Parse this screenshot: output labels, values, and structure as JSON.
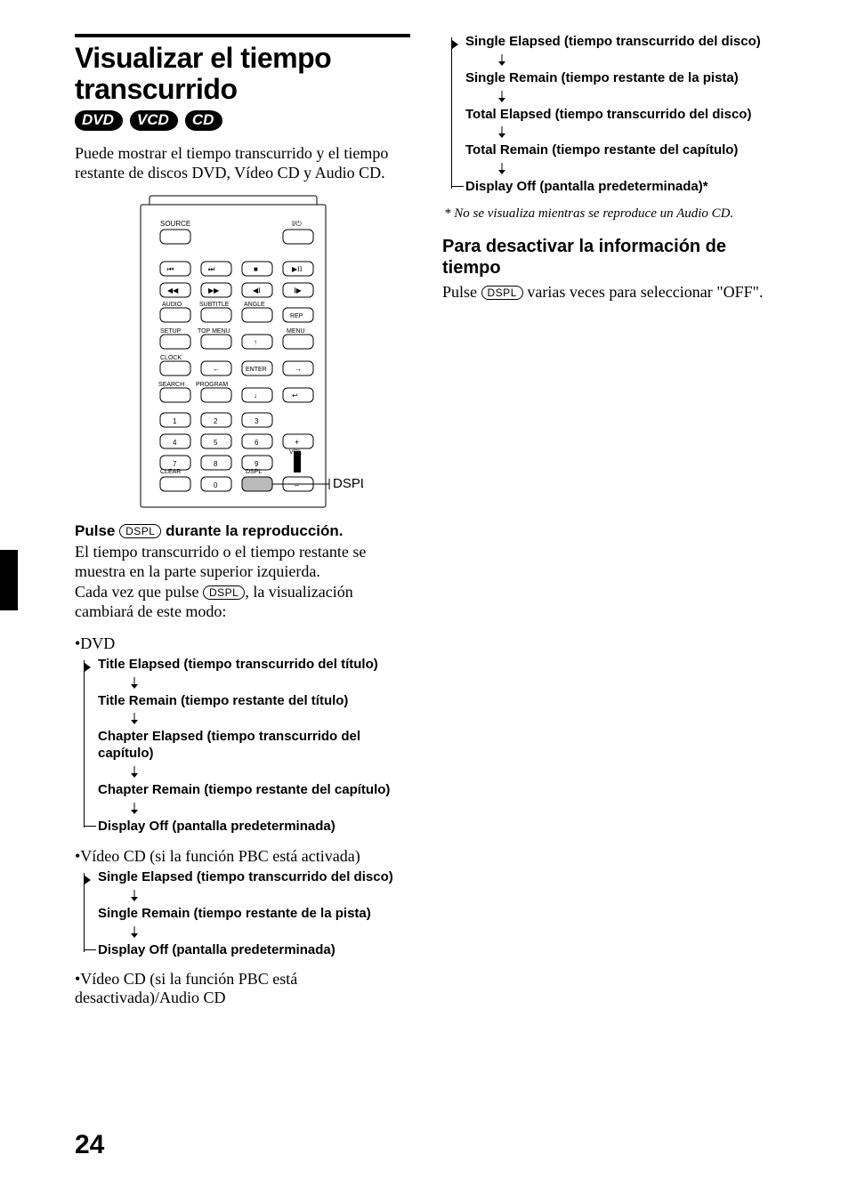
{
  "pageNumber": "24",
  "heading": "Visualizar el tiempo transcurrido",
  "badges": [
    "DVD",
    "VCD",
    "CD"
  ],
  "intro": "Puede mostrar el tiempo transcurrido y el tiempo restante de discos DVD, Vídeo CD y Audio CD.",
  "remote": {
    "labels": {
      "source": "SOURCE",
      "power": "⏻",
      "audio": "AUDIO",
      "subtitle": "SUBTITLE",
      "angle": "ANGLE",
      "rep": "REP",
      "setup": "SETUP",
      "topmenu": "TOP MENU",
      "menu": "MENU",
      "clock": "CLOCK",
      "enter": "ENTER",
      "search": "SEARCH",
      "program": "PROGRAM",
      "clear": "CLEAR",
      "dspl": "DSPL",
      "vol": "VOL"
    },
    "callout": "DSPL"
  },
  "instruction": {
    "prefix": "Pulse ",
    "button": "DSPL",
    "suffix": " durante la reproducción.",
    "line2": "El tiempo transcurrido o el tiempo restante se muestra en la parte superior izquierda.",
    "line3a": "Cada vez que pulse ",
    "line3btn": "DSPL",
    "line3b": ", la visualización cambiará de este modo:"
  },
  "sections": [
    {
      "head": "•DVD",
      "items": [
        "Title Elapsed (tiempo transcurrido del título)",
        "Title Remain (tiempo restante del título)",
        "Chapter Elapsed (tiempo transcurrido del capítulo)",
        "Chapter Remain (tiempo restante del capítulo)",
        "Display Off (pantalla predeterminada)"
      ]
    },
    {
      "head": "•Vídeo CD (si la función PBC está activada)",
      "items": [
        "Single Elapsed (tiempo transcurrido del disco)",
        "Single Remain (tiempo restante de la pista)",
        "Display Off (pantalla predeterminada)"
      ]
    },
    {
      "head": "•Vídeo CD (si la función PBC está desactivada)/Audio CD",
      "items": [
        "Single Elapsed (tiempo transcurrido del disco)",
        "Single Remain (tiempo restante de la pista)",
        "Total Elapsed (tiempo transcurrido del disco)",
        "Total Remain (tiempo restante del capítulo)",
        "Display Off (pantalla predeterminada)*"
      ]
    }
  ],
  "footnote": "* No se visualiza mientras  se reproduce un Audio CD.",
  "sub": {
    "title": "Para desactivar la información de tiempo",
    "textA": "Pulse ",
    "btn": "DSPL",
    "textB": " varias veces para seleccionar \"OFF\"."
  }
}
